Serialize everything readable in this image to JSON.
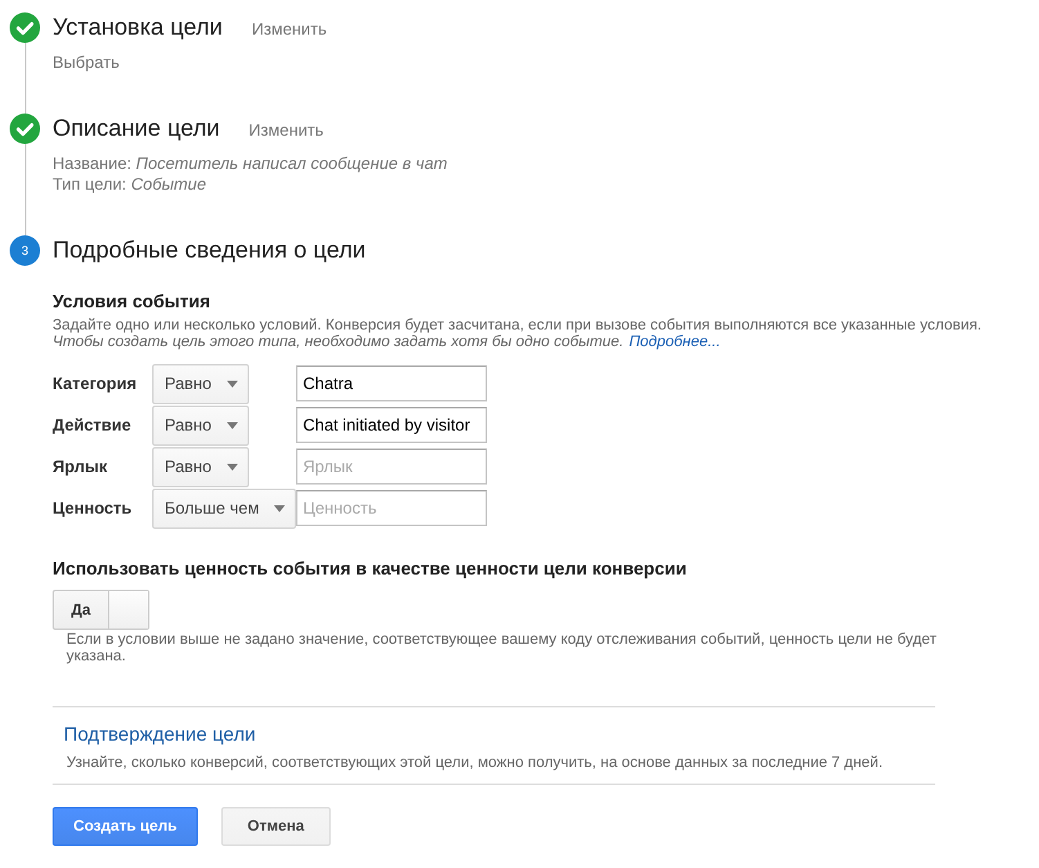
{
  "steps": [
    {
      "completed": true,
      "title": "Установка цели",
      "edit_link": "Изменить",
      "details": [
        "Выбрать"
      ]
    },
    {
      "completed": true,
      "title": "Описание цели",
      "edit_link": "Изменить",
      "details": [
        "Название: *Посетитель написал сообщение в чат*",
        "Тип цели: *Событие*"
      ]
    },
    {
      "completed": false,
      "number": "3",
      "title": "Подробные сведения о цели"
    }
  ],
  "event_conditions": {
    "title": "Условия события",
    "description": "Задайте одно или несколько условий. Конверсия будет засчитана, если при вызове события выполняются все указанные условия.",
    "note": "Чтобы создать цель этого типа, необходимо задать хотя бы одно событие.",
    "link": "Подробнее...",
    "rows": [
      {
        "label": "Категория",
        "operator": "Равно",
        "value": "Chatra"
      },
      {
        "label": "Действие",
        "operator": "Равно",
        "value": "Chat initiated by visitor"
      },
      {
        "label": "Ярлык",
        "operator": "Равно",
        "placeholder": "Ярлык"
      },
      {
        "label": "Ценность",
        "operator": "Больше чем",
        "placeholder": "Ценность"
      }
    ]
  },
  "use_event_value": {
    "title": "Использовать ценность события в качестве ценности цели конверсии",
    "toggle": {
      "label": "Да",
      "on": true
    },
    "description": "Если в условии выше не задано значение, соответствующее вашему коду отслеживания событий, ценность цели не будет указана."
  },
  "verification": {
    "link": "Подтверждение цели",
    "description": "Узнайте, сколько конверсий, соответствующих этой цели, можно получить, на основе данных за последние 7 дней."
  },
  "buttons": [
    {
      "label": "Создать цель",
      "kind": "primary"
    },
    {
      "label": "Отмена",
      "kind": "secondary"
    }
  ]
}
